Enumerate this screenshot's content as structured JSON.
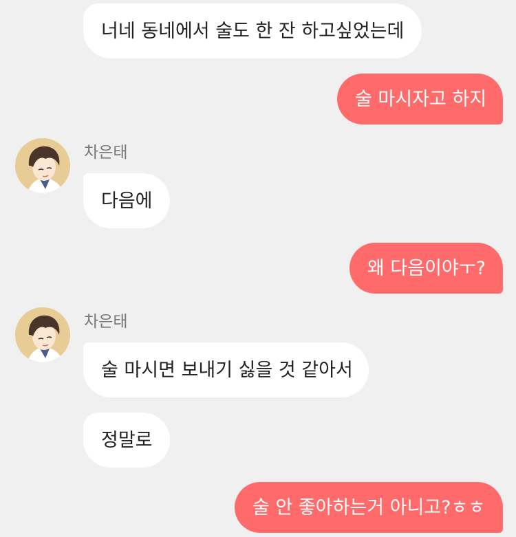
{
  "messages": [
    {
      "side": "in",
      "text": "너네 동네에서 술도 한 잔 하고싶었는데"
    },
    {
      "side": "out",
      "text": "술 마시자고 하지"
    },
    {
      "side": "in",
      "sender": "차은태",
      "text": "다음에"
    },
    {
      "side": "out",
      "text": "왜 다음이야ㅜ?"
    },
    {
      "side": "in",
      "sender": "차은태",
      "text": "술 마시면 보내기 싫을 것 같아서"
    },
    {
      "side": "in",
      "text": "정말로"
    },
    {
      "side": "out",
      "text": "술 안 좋아하는거 아니고?ㅎㅎ"
    }
  ],
  "colors": {
    "background": "#f0f0f0",
    "incoming_bubble": "#ffffff",
    "outgoing_bubble": "#ff6b6b",
    "sender_name": "#777777"
  },
  "avatar_icon": "profile-avatar-icon"
}
